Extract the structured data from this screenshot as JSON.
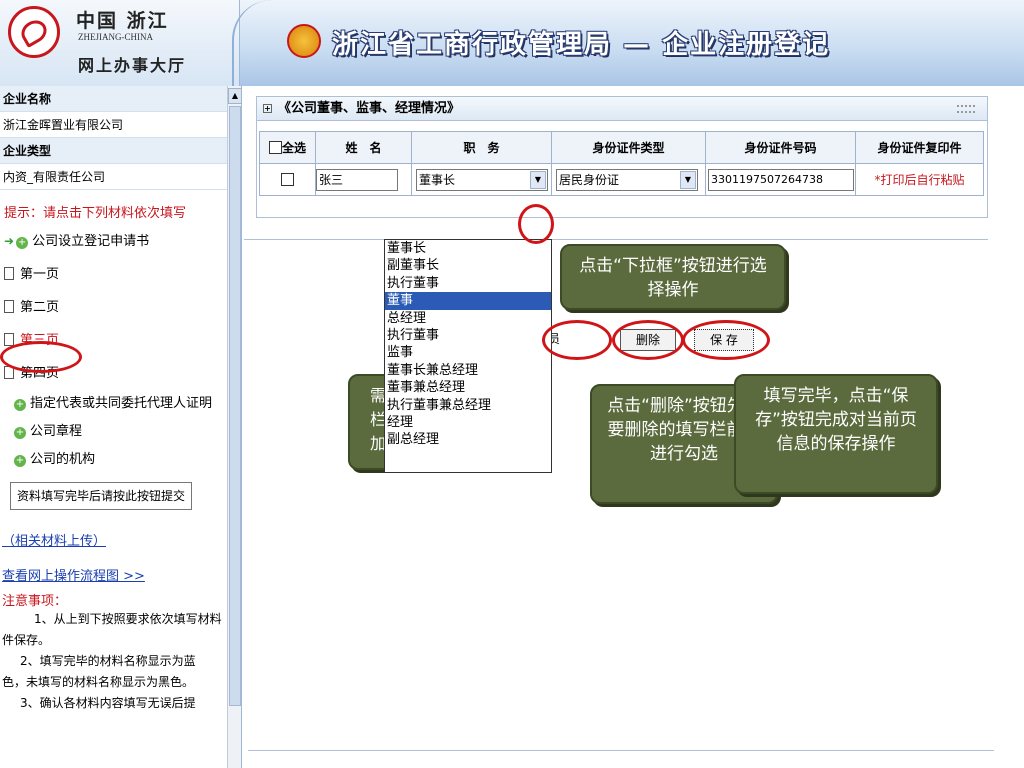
{
  "header": {
    "logo_cn": "中国 浙江",
    "logo_en": "ZHEJIANG-CHINA",
    "logo_sub": "网上办事大厅",
    "title": "浙江省工商行政管理局 — 企业注册登记"
  },
  "sidebar": {
    "company_name_label": "企业名称",
    "company_name_value": "浙江金晖置业有限公司",
    "company_type_label": "企业类型",
    "company_type_value": "内资_有限责任公司",
    "hint": "提示：请点击下列材料依次填写",
    "items": [
      {
        "label": "公司设立登记申请书",
        "icon": "arrow-plus-icon"
      },
      {
        "label": "第一页",
        "icon": "page-icon"
      },
      {
        "label": "第二页",
        "icon": "page-icon"
      },
      {
        "label": "第三页",
        "icon": "page-icon"
      },
      {
        "label": "第四页",
        "icon": "page-icon"
      },
      {
        "label": "指定代表或共同委托代理人证明",
        "icon": "plus-icon"
      },
      {
        "label": "公司章程",
        "icon": "plus-icon"
      },
      {
        "label": "公司的机构",
        "icon": "plus-icon"
      }
    ],
    "submit_label": "资料填写完毕后请按此按钮提交",
    "upload_link": "（相关材料上传）",
    "flow_link": "查看网上操作流程图 >>",
    "notes_title": "注意事项：",
    "notes": [
      "1、从上到下按照要求依次填写材料",
      "件保存。",
      "2、填写完毕的材料名称显示为蓝",
      "色，未填写的材料名称显示为黑色。",
      "3、确认各材料内容填写无误后提"
    ]
  },
  "panel": {
    "title": "《公司董事、监事、经理情况》",
    "headers": [
      "全选",
      "姓　名",
      "职　务",
      "身份证件类型",
      "身份证件号码",
      "身份证件复印件"
    ],
    "row": {
      "name": "张三",
      "position": "董事长",
      "id_type": "居民身份证",
      "id_number": "330119750726473​8",
      "copy_note": "*打印后自行粘贴"
    }
  },
  "buttons": {
    "add_partial": "员",
    "delete": "删除",
    "save": "保 存"
  },
  "dropdown_options": [
    "董事长",
    "副董事长",
    "执行董事",
    "董事",
    "总经理",
    "执行董事",
    "监事",
    "董事长兼总经理",
    "董事兼总经理",
    "执行董事兼总经理",
    "经理",
    "副总经理"
  ],
  "dropdown_selected_index": 3,
  "callouts": {
    "dropdown_tip": "点击“下拉框”按钮进行选择操作",
    "delete_tip": "点击“删除”按钮先在要删除的填写栏前面进行勾选",
    "save_tip": "填写完毕，点击“保存”按钮完成对当前页信息的保存操作",
    "hidden_tip_fragment": "需\n栏\n加"
  },
  "colors": {
    "accent_red": "#d01518",
    "callout_bg": "#5b6b3e",
    "header_blue": "#a9c5e6",
    "dropdown_selected": "#2c5bb6"
  }
}
